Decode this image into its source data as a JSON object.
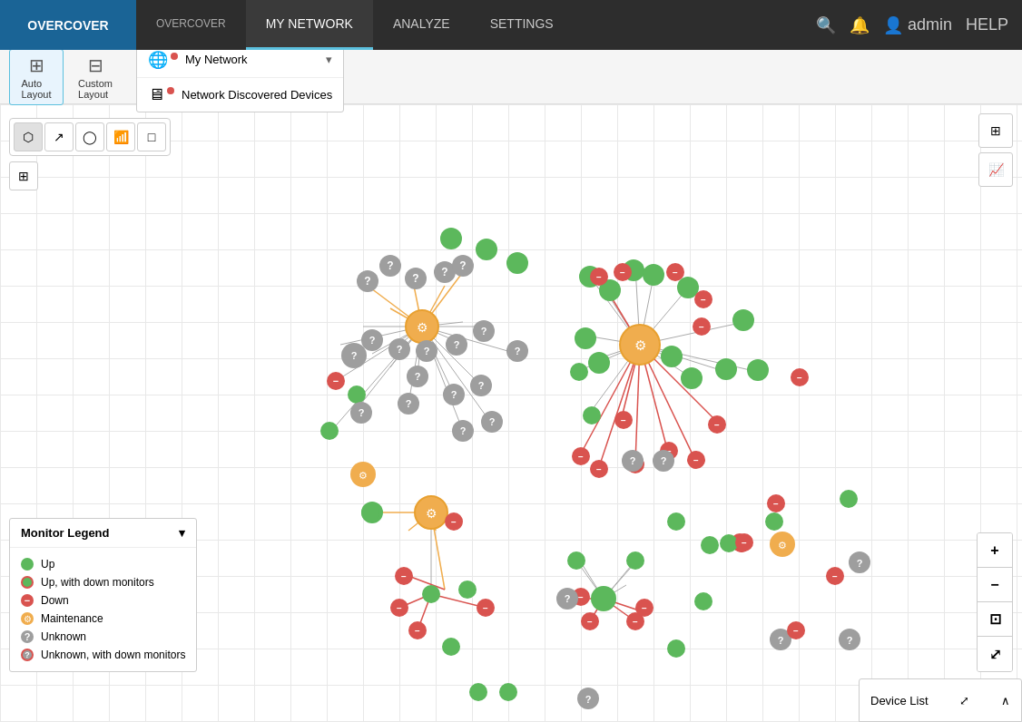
{
  "nav": {
    "logo": "OVERCOVER",
    "items": [
      {
        "label": "OVERCOVER",
        "active": false
      },
      {
        "label": "MY NETWORK",
        "active": true
      },
      {
        "label": "ANALYZE",
        "active": false
      },
      {
        "label": "SETTINGS",
        "active": false
      }
    ],
    "right": {
      "search_icon": "🔍",
      "bell_icon": "🔔",
      "user": "admin",
      "help": "HELP"
    }
  },
  "layout": {
    "auto_label": "Auto\nLayout",
    "custom_label": "Custom\nLayout"
  },
  "dropdown": {
    "my_network": "My Network",
    "discovered_devices": "Network Discovered Devices"
  },
  "map_tools": [
    "⬡",
    "↗",
    "○",
    "📶",
    "□"
  ],
  "legend": {
    "title": "Monitor Legend",
    "items": [
      {
        "label": "Up",
        "color": "green"
      },
      {
        "label": "Up, with down monitors",
        "color": "green-down"
      },
      {
        "label": "Down",
        "color": "red"
      },
      {
        "label": "Maintenance",
        "color": "orange"
      },
      {
        "label": "Unknown",
        "color": "gray"
      },
      {
        "label": "Unknown, with down monitors",
        "color": "gray-red"
      }
    ]
  },
  "device_list": {
    "label": "Device List",
    "expand_icon": "⤢",
    "collapse_icon": "∧"
  },
  "zoom": {
    "plus": "+",
    "minus": "−",
    "fit": "⊡",
    "expand": "⤢"
  }
}
